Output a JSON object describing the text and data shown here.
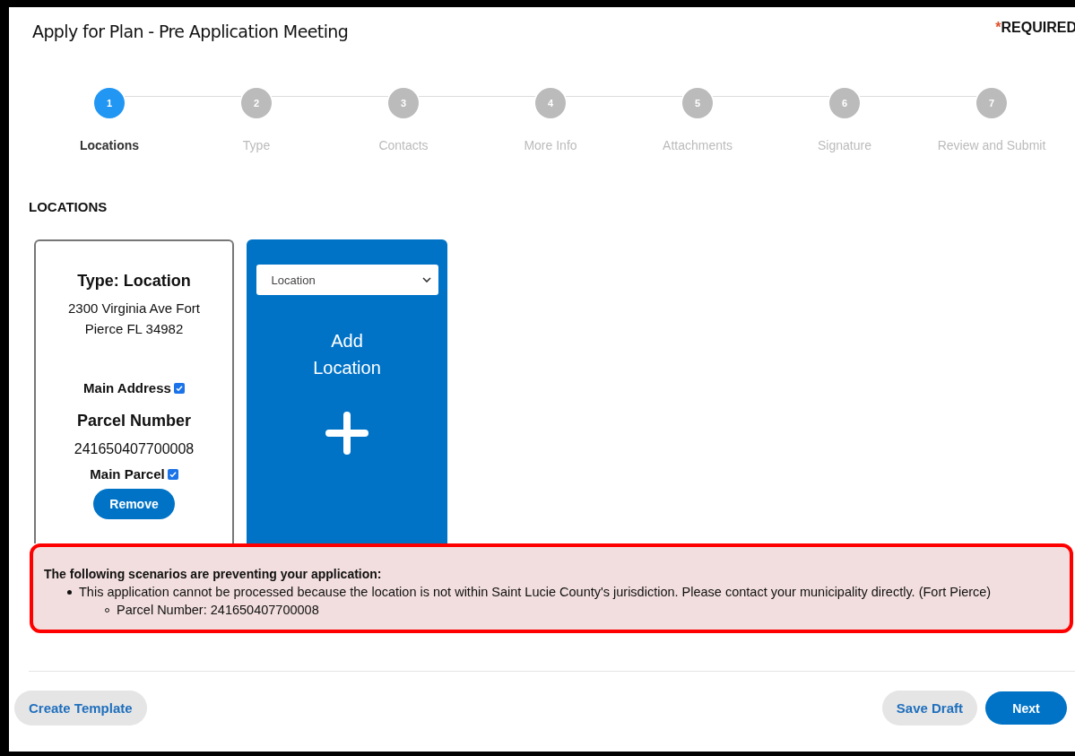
{
  "title": "Apply for Plan - Pre Application Meeting",
  "required": {
    "mark": "*",
    "label": "REQUIRED"
  },
  "steps": [
    {
      "number": "1",
      "label": "Locations",
      "selected": true
    },
    {
      "number": "2",
      "label": "Type",
      "selected": false
    },
    {
      "number": "3",
      "label": "Contacts",
      "selected": false
    },
    {
      "number": "4",
      "label": "More Info",
      "selected": false
    },
    {
      "number": "5",
      "label": "Attachments",
      "selected": false
    },
    {
      "number": "6",
      "label": "Signature",
      "selected": false
    },
    {
      "number": "7",
      "label": "Review and Submit",
      "selected": false
    }
  ],
  "section_title": "LOCATIONS",
  "location_card": {
    "type": "Type: Location",
    "address": "2300 Virginia Ave Fort Pierce FL 34982",
    "main_address": {
      "label": "Main Address",
      "checked": true
    },
    "parcel_heading": "Parcel Number",
    "parcel": "241650407700008",
    "main_parcel": {
      "label": "Main Parcel",
      "checked": true
    },
    "remove": "Remove"
  },
  "add_card": {
    "select": "Location",
    "label": "Add Location"
  },
  "error": {
    "heading": "The following scenarios are preventing your application:",
    "items": [
      {
        "text": "This application cannot be processed because the location is not within Saint Lucie County's jurisdiction. Please contact your municipality directly. (Fort Pierce)",
        "children": [
          {
            "text": "Parcel Number: 241650407700008"
          }
        ]
      }
    ]
  },
  "buttons": {
    "create_template": "Create Template",
    "save_draft": "Save Draft",
    "next": "Next"
  }
}
